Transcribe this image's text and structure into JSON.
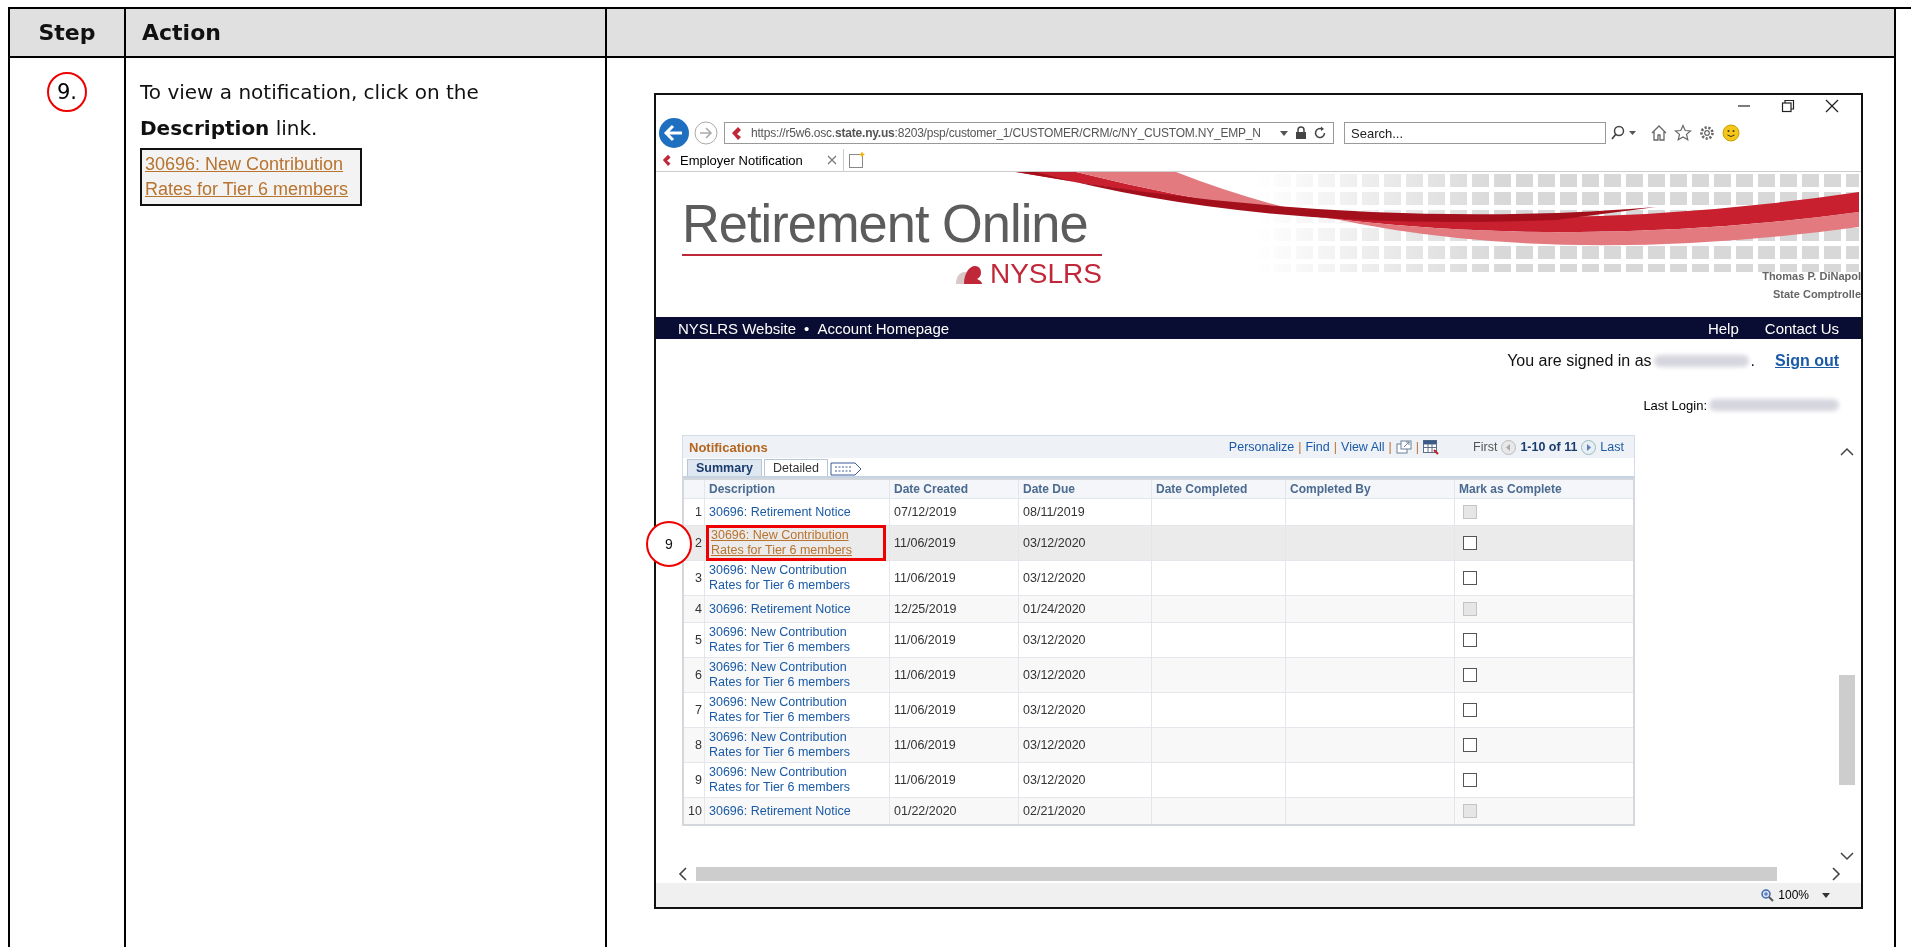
{
  "doc_table": {
    "columns": [
      "Step",
      "Action"
    ]
  },
  "step": {
    "number": "9.",
    "instruction": "To view a notification, click on the **Description** link.",
    "example_link": "30696: New Contribution Rates for Tier 6 members"
  },
  "browser": {
    "url": "https://r5w6.osc.**state.ny.us**:8203/psp/customer_1/CUSTOMER/CRM/c/NY_CUSTOM.NY_EMP_N",
    "search_placeholder": "Search...",
    "tabs": [
      {
        "title": "Employer Notification",
        "selected": true
      }
    ],
    "zoom": "100%"
  },
  "site": {
    "logo_title": "Retirement Online",
    "logo_subtitle": "NYSLRS",
    "official_name": "Thomas P. DiNapol",
    "official_title": "State Comptrolle",
    "nav_left": [
      "NYSLRS Website",
      "Account Homepage"
    ],
    "nav_separator": "•",
    "nav_right": [
      "Help",
      "Contact Us"
    ],
    "signed_in_label": "You are signed in as",
    "signed_in_end": ".",
    "sign_out": "Sign out",
    "last_login_label": "Last Login:"
  },
  "grid": {
    "title": "Notifications",
    "toolbar": [
      {
        "kind": "link",
        "label": "Personalize"
      },
      {
        "kind": "sep",
        "label": "|"
      },
      {
        "kind": "link",
        "label": "Find"
      },
      {
        "kind": "sep",
        "label": "|"
      },
      {
        "kind": "link",
        "label": "View All"
      },
      {
        "kind": "sep",
        "label": "|"
      },
      {
        "kind": "zoom"
      },
      {
        "kind": "sep",
        "label": "|"
      },
      {
        "kind": "download"
      }
    ],
    "first": "First",
    "range": "1-10 of 11",
    "last": "Last",
    "tabs": [
      {
        "label": "Summary",
        "selected": true
      },
      {
        "label": "Detailed",
        "selected": false
      }
    ],
    "columns": [
      "Description",
      "Date Created",
      "Date Due",
      "Date Completed",
      "Completed By",
      "Mark as Complete"
    ],
    "rows": [
      {
        "number": "1",
        "description": "30696: Retirement Notice",
        "date_created": "07/12/2019",
        "date_due": "08/11/2019",
        "selected": false,
        "checked": false,
        "disabled": true
      },
      {
        "number": "2",
        "description": "30696: New Contribution Rates for Tier 6 members",
        "date_created": "11/06/2019",
        "date_due": "03/12/2020",
        "selected": true,
        "checked": false,
        "disabled": false,
        "callout": "9"
      },
      {
        "number": "3",
        "description": "30696: New Contribution Rates for Tier 6 members",
        "date_created": "11/06/2019",
        "date_due": "03/12/2020",
        "selected": false,
        "checked": false,
        "disabled": false
      },
      {
        "number": "4",
        "description": "30696: Retirement Notice",
        "date_created": "12/25/2019",
        "date_due": "01/24/2020",
        "selected": false,
        "checked": false,
        "disabled": true
      },
      {
        "number": "5",
        "description": "30696: New Contribution Rates for Tier 6 members",
        "date_created": "11/06/2019",
        "date_due": "03/12/2020",
        "selected": false,
        "checked": false,
        "disabled": false
      },
      {
        "number": "6",
        "description": "30696: New Contribution Rates for Tier 6 members",
        "date_created": "11/06/2019",
        "date_due": "03/12/2020",
        "selected": false,
        "checked": false,
        "disabled": false
      },
      {
        "number": "7",
        "description": "30696: New Contribution Rates for Tier 6 members",
        "date_created": "11/06/2019",
        "date_due": "03/12/2020",
        "selected": false,
        "checked": false,
        "disabled": false
      },
      {
        "number": "8",
        "description": "30696: New Contribution Rates for Tier 6 members",
        "date_created": "11/06/2019",
        "date_due": "03/12/2020",
        "selected": false,
        "checked": false,
        "disabled": false
      },
      {
        "number": "9",
        "description": "30696: New Contribution Rates for Tier 6 members",
        "date_created": "11/06/2019",
        "date_due": "03/12/2020",
        "selected": false,
        "checked": false,
        "disabled": false
      },
      {
        "number": "10",
        "description": "30696: Retirement Notice",
        "date_created": "01/22/2020",
        "date_due": "02/21/2020",
        "selected": false,
        "checked": false,
        "disabled": true
      }
    ]
  }
}
